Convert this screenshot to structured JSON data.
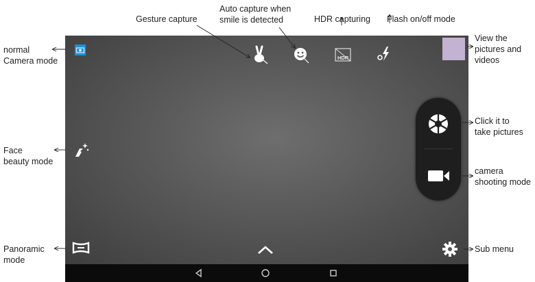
{
  "labels": {
    "gesture": "Gesture capture",
    "smile_1": "Auto capture when",
    "smile_2": "smile is detected",
    "hdr": "HDR capturing",
    "flash": "Flash on/off mode",
    "view_1": "View the",
    "view_2": "pictures and",
    "view_3": "videos",
    "normal_1": "normal",
    "normal_2": "Camera mode",
    "face_1": "Face",
    "face_2": "beauty mode",
    "pano_1": "Panoramic",
    "pano_2": "mode",
    "click_1": "Click it to",
    "click_2": "take pictures",
    "shoot_1": "camera",
    "shoot_2": "shooting mode",
    "submenu": "Sub menu"
  },
  "hdr_icon_text": "HDR",
  "colors": {
    "accent_blue": "#1f8fd6",
    "thumbnail": "#c4b2d2",
    "screen": "#585858",
    "navbar": "#0b0b0b"
  },
  "icons": [
    "normal-camera-mode-icon",
    "gesture-capture-icon",
    "smile-capture-icon",
    "hdr-icon",
    "flash-icon",
    "gallery-thumbnail",
    "face-beauty-icon",
    "shutter-icon",
    "video-camera-icon",
    "panorama-icon",
    "chevron-up-icon",
    "settings-gear-icon",
    "nav-back-icon",
    "nav-home-icon",
    "nav-recent-icon"
  ]
}
